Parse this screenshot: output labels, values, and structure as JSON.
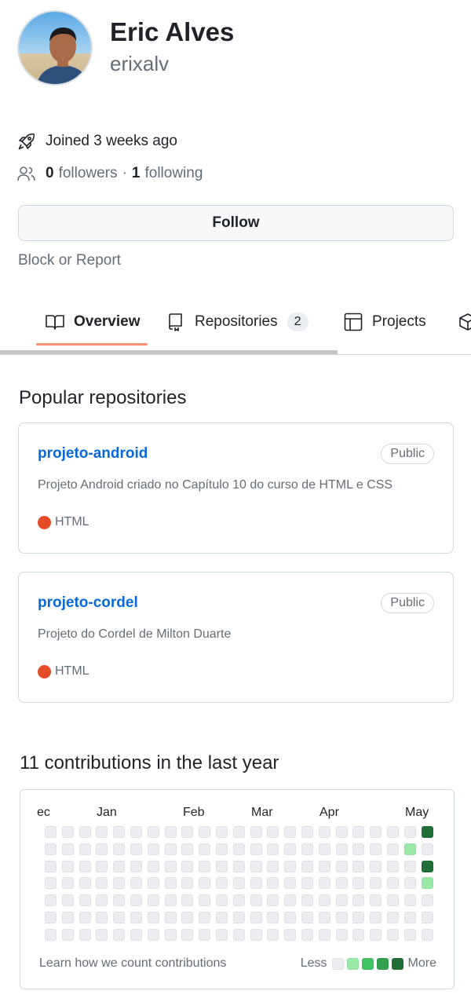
{
  "profile": {
    "name": "Eric Alves",
    "login": "erixalv",
    "joined": "Joined 3 weeks ago",
    "followers_count": "0",
    "followers_label": "followers",
    "separator": "·",
    "following_count": "1",
    "following_label": "following"
  },
  "actions": {
    "follow_label": "Follow",
    "block_label": "Block or Report"
  },
  "tabs": [
    {
      "label": "Overview",
      "icon": "book-icon",
      "selected": true
    },
    {
      "label": "Repositories",
      "icon": "repo-icon",
      "counter": "2"
    },
    {
      "label": "Projects",
      "icon": "table-icon"
    },
    {
      "label": "",
      "icon": "package-icon"
    }
  ],
  "popular": {
    "title": "Popular repositories",
    "repos": [
      {
        "name": "projeto-android",
        "visibility": "Public",
        "description": "Projeto Android criado no Capítulo 10 do curso de HTML e CSS",
        "language": "HTML",
        "language_color": "#e34c26"
      },
      {
        "name": "projeto-cordel",
        "visibility": "Public",
        "description": "Projeto do Cordel de Milton Duarte",
        "language": "HTML",
        "language_color": "#e34c26"
      }
    ]
  },
  "contributions": {
    "title": "11 contributions in the last year",
    "months": [
      "ec",
      "Jan",
      "Feb",
      "Mar",
      "Apr",
      "May"
    ],
    "weeks": 23,
    "days": 7,
    "active_cells": [
      {
        "week": 22,
        "day": 0,
        "level": 4
      },
      {
        "week": 21,
        "day": 1,
        "level": 1
      },
      {
        "week": 22,
        "day": 2,
        "level": 4
      },
      {
        "week": 22,
        "day": 3,
        "level": 1
      }
    ],
    "level_colors": [
      "#ebedf0",
      "#9be9a8",
      "#40c463",
      "#30a14e",
      "#216e39"
    ],
    "learn_label": "Learn how we count contributions",
    "less_label": "Less",
    "more_label": "More"
  }
}
